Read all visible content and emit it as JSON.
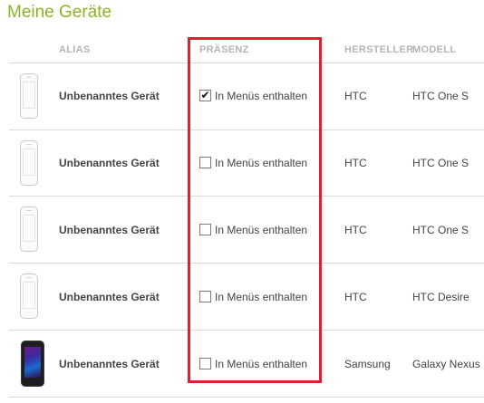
{
  "page": {
    "title": "Meine Geräte"
  },
  "table": {
    "headers": {
      "alias": "ALIAS",
      "presence": "PRÄSENZ",
      "manufacturer": "HERSTELLER",
      "model": "MODELL"
    },
    "rows": [
      {
        "alias": "Unbenanntes Gerät",
        "presence_label": "In Menüs enthalten",
        "checked": true,
        "checkmark": "✔",
        "manufacturer": "HTC",
        "model": "HTC One S",
        "icon": "white-phone-icon"
      },
      {
        "alias": "Unbenanntes Gerät",
        "presence_label": "In Menüs enthalten",
        "checked": false,
        "checkmark": "",
        "manufacturer": "HTC",
        "model": "HTC One S",
        "icon": "white-phone-icon"
      },
      {
        "alias": "Unbenanntes Gerät",
        "presence_label": "In Menüs enthalten",
        "checked": false,
        "checkmark": "",
        "manufacturer": "HTC",
        "model": "HTC One S",
        "icon": "white-phone-icon"
      },
      {
        "alias": "Unbenanntes Gerät",
        "presence_label": "In Menüs enthalten",
        "checked": false,
        "checkmark": "",
        "manufacturer": "HTC",
        "model": "HTC Desire",
        "icon": "white-phone-icon"
      },
      {
        "alias": "Unbenanntes Gerät",
        "presence_label": "In Menüs enthalten",
        "checked": false,
        "checkmark": "",
        "manufacturer": "Samsung",
        "model": "Galaxy Nexus",
        "icon": "dark-phone-icon"
      }
    ]
  },
  "colors": {
    "title": "#8cb32a",
    "header": "#b4b4b4",
    "highlight": "#e0202e",
    "divider": "#d9d9d9"
  }
}
